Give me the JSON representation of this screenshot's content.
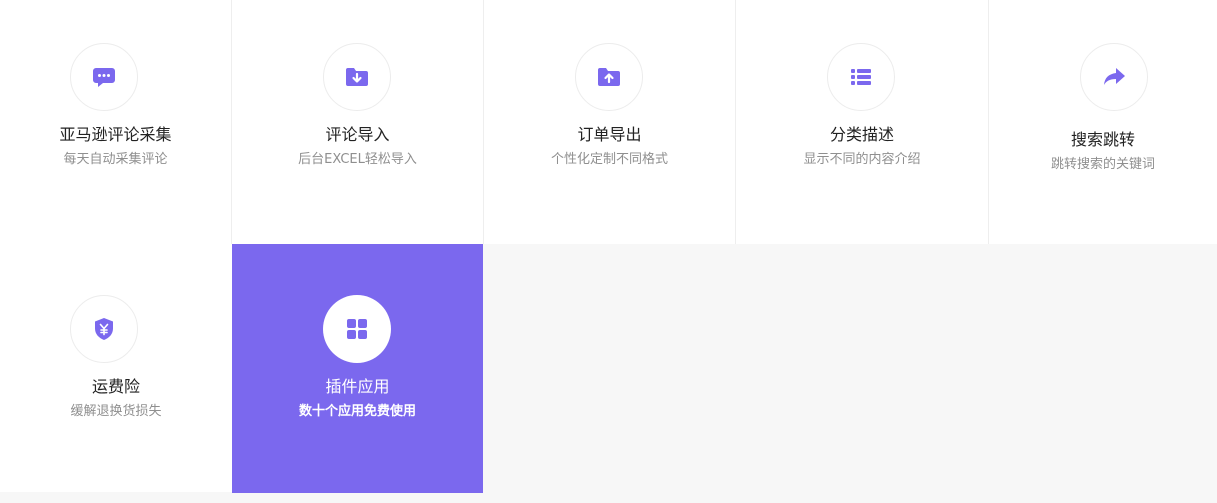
{
  "colors": {
    "accent": "#7b68ee",
    "tile_bg": "#ffffff",
    "page_bg": "#f7f7f7",
    "title_text": "#222222",
    "subtitle_text": "#8f8f8f"
  },
  "features": [
    {
      "title": "亚马逊评论采集",
      "subtitle": "每天自动采集评论",
      "icon": "chat-bubble-icon",
      "active": false
    },
    {
      "title": "评论导入",
      "subtitle": "后台EXCEL轻松导入",
      "icon": "folder-download-icon",
      "active": false
    },
    {
      "title": "订单导出",
      "subtitle": "个性化定制不同格式",
      "icon": "folder-upload-icon",
      "active": false
    },
    {
      "title": "分类描述",
      "subtitle": "显示不同的内容介绍",
      "icon": "list-icon",
      "active": false
    },
    {
      "title": "搜索跳转",
      "subtitle": "跳转搜索的关键词",
      "icon": "share-arrow-icon",
      "active": false
    },
    {
      "title": "运费险",
      "subtitle": "缓解退换货损失",
      "icon": "yuan-shield-icon",
      "active": false
    },
    {
      "title": "插件应用",
      "subtitle": "数十个应用免费使用",
      "icon": "grid-apps-icon",
      "active": true
    }
  ]
}
